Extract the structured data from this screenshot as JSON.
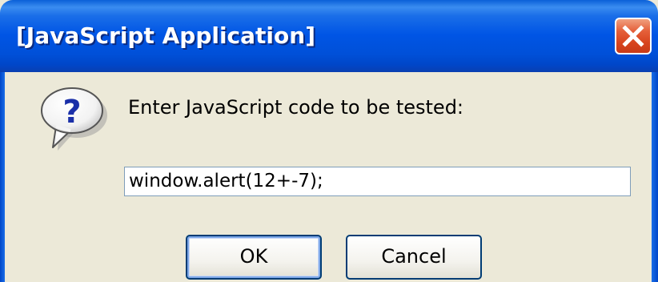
{
  "window": {
    "title": "[JavaScript Application]",
    "close_icon": "close-icon"
  },
  "dialog": {
    "icon": "question-icon",
    "prompt": "Enter JavaScript code to be tested:",
    "input_value": "window.alert(12+-7);"
  },
  "buttons": {
    "ok_label": "OK",
    "cancel_label": "Cancel"
  },
  "colors": {
    "titlebar": "#0055e5",
    "dialog_bg": "#ece9d8",
    "close_button": "#e0502a",
    "button_border": "#003c74",
    "input_border": "#7f9db9",
    "question_mark": "#1a2fa8"
  }
}
